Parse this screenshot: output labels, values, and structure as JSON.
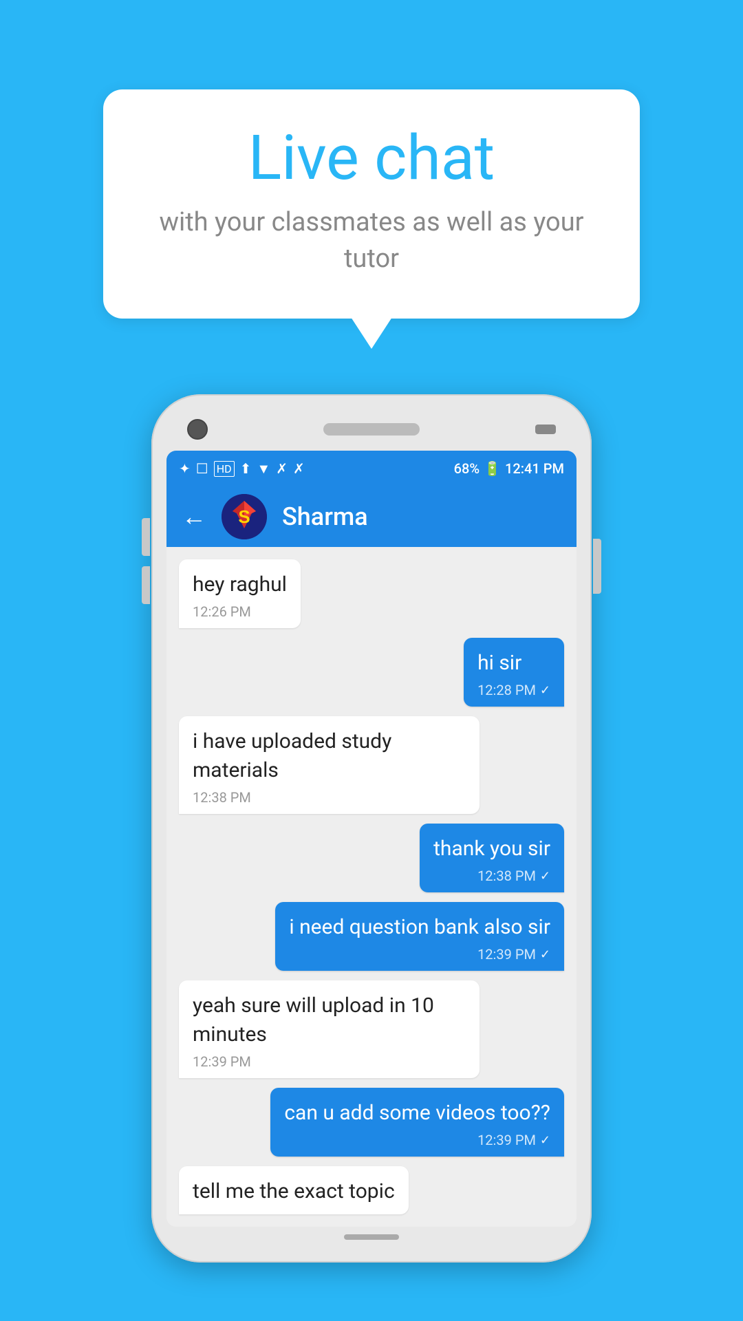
{
  "background_color": "#29B6F6",
  "bubble": {
    "title": "Live chat",
    "subtitle": "with your classmates as well as your tutor"
  },
  "phone": {
    "status_bar": {
      "left_icons": "✦  ☐  HD ⬆  ▼  ✗  ✗",
      "battery": "68%",
      "time": "12:41 PM"
    },
    "header": {
      "back_label": "←",
      "contact_name": "Sharma"
    },
    "messages": [
      {
        "id": "msg1",
        "type": "received",
        "text": "hey raghul",
        "time": "12:26 PM"
      },
      {
        "id": "msg2",
        "type": "sent",
        "text": "hi sir",
        "time": "12:28 PM"
      },
      {
        "id": "msg3",
        "type": "received",
        "text": "i have uploaded study materials",
        "time": "12:38 PM"
      },
      {
        "id": "msg4",
        "type": "sent",
        "text": "thank you sir",
        "time": "12:38 PM"
      },
      {
        "id": "msg5",
        "type": "sent",
        "text": "i need question bank also sir",
        "time": "12:39 PM"
      },
      {
        "id": "msg6",
        "type": "received",
        "text": "yeah sure will upload in 10 minutes",
        "time": "12:39 PM"
      },
      {
        "id": "msg7",
        "type": "sent",
        "text": "can u add some videos too??",
        "time": "12:39 PM"
      },
      {
        "id": "msg8",
        "type": "received",
        "text": "tell me the exact topic",
        "time": "",
        "partial": true
      }
    ]
  }
}
